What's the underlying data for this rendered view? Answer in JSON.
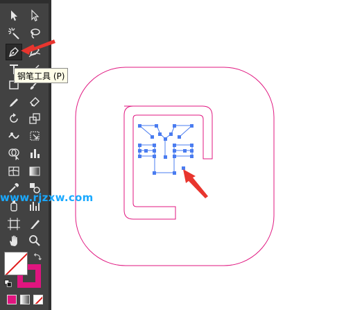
{
  "tooltip": {
    "text": "钢笔工具 (P)"
  },
  "watermark": {
    "text": "www.rjzxw.com"
  },
  "toolbar": {
    "tools": [
      {
        "name": "selection-tool",
        "icon": "black-arrow-icon"
      },
      {
        "name": "direct-selection-tool",
        "icon": "white-arrow-icon"
      },
      {
        "name": "magic-wand-tool",
        "icon": "magic-wand-icon"
      },
      {
        "name": "lasso-tool",
        "icon": "lasso-icon"
      },
      {
        "name": "pen-tool",
        "icon": "pen-icon",
        "active": true
      },
      {
        "name": "curvature-tool",
        "icon": "curvature-pen-icon"
      },
      {
        "name": "type-tool",
        "icon": "type-icon"
      },
      {
        "name": "line-segment-tool",
        "icon": "line-icon"
      },
      {
        "name": "rectangle-tool",
        "icon": "rectangle-icon"
      },
      {
        "name": "paintbrush-tool",
        "icon": "brush-icon"
      },
      {
        "name": "pencil-tool",
        "icon": "pencil-icon"
      },
      {
        "name": "eraser-tool",
        "icon": "eraser-icon"
      },
      {
        "name": "rotate-tool",
        "icon": "rotate-icon"
      },
      {
        "name": "scale-tool",
        "icon": "scale-icon"
      },
      {
        "name": "warp-tool",
        "icon": "warp-icon"
      },
      {
        "name": "free-transform-tool",
        "icon": "free-transform-icon"
      },
      {
        "name": "shape-builder-tool",
        "icon": "shape-builder-icon"
      },
      {
        "name": "graph-tool",
        "icon": "bar-graph-icon"
      },
      {
        "name": "mesh-tool",
        "icon": "mesh-icon"
      },
      {
        "name": "gradient-tool",
        "icon": "gradient-icon"
      },
      {
        "name": "eyedropper-tool",
        "icon": "eyedropper-icon"
      },
      {
        "name": "blend-tool",
        "icon": "blend-icon"
      },
      {
        "name": "symbol-sprayer-tool",
        "icon": "symbol-sprayer-icon"
      },
      {
        "name": "column-graph-tool",
        "icon": "column-graph-icon"
      },
      {
        "name": "artboard-tool",
        "icon": "artboard-icon"
      },
      {
        "name": "slice-tool",
        "icon": "slice-icon"
      },
      {
        "name": "hand-tool",
        "icon": "hand-icon"
      },
      {
        "name": "zoom-tool",
        "icon": "magnifier-icon"
      }
    ],
    "fill_color": "#ffffff",
    "stroke_color": "#e0157f",
    "color_modes": [
      "color",
      "gradient",
      "none"
    ]
  },
  "artwork": {
    "stroke_color": "#e0157f",
    "anchor_color": "#4a7cf0"
  },
  "annotations": {
    "arrow_color": "#e8352e"
  }
}
